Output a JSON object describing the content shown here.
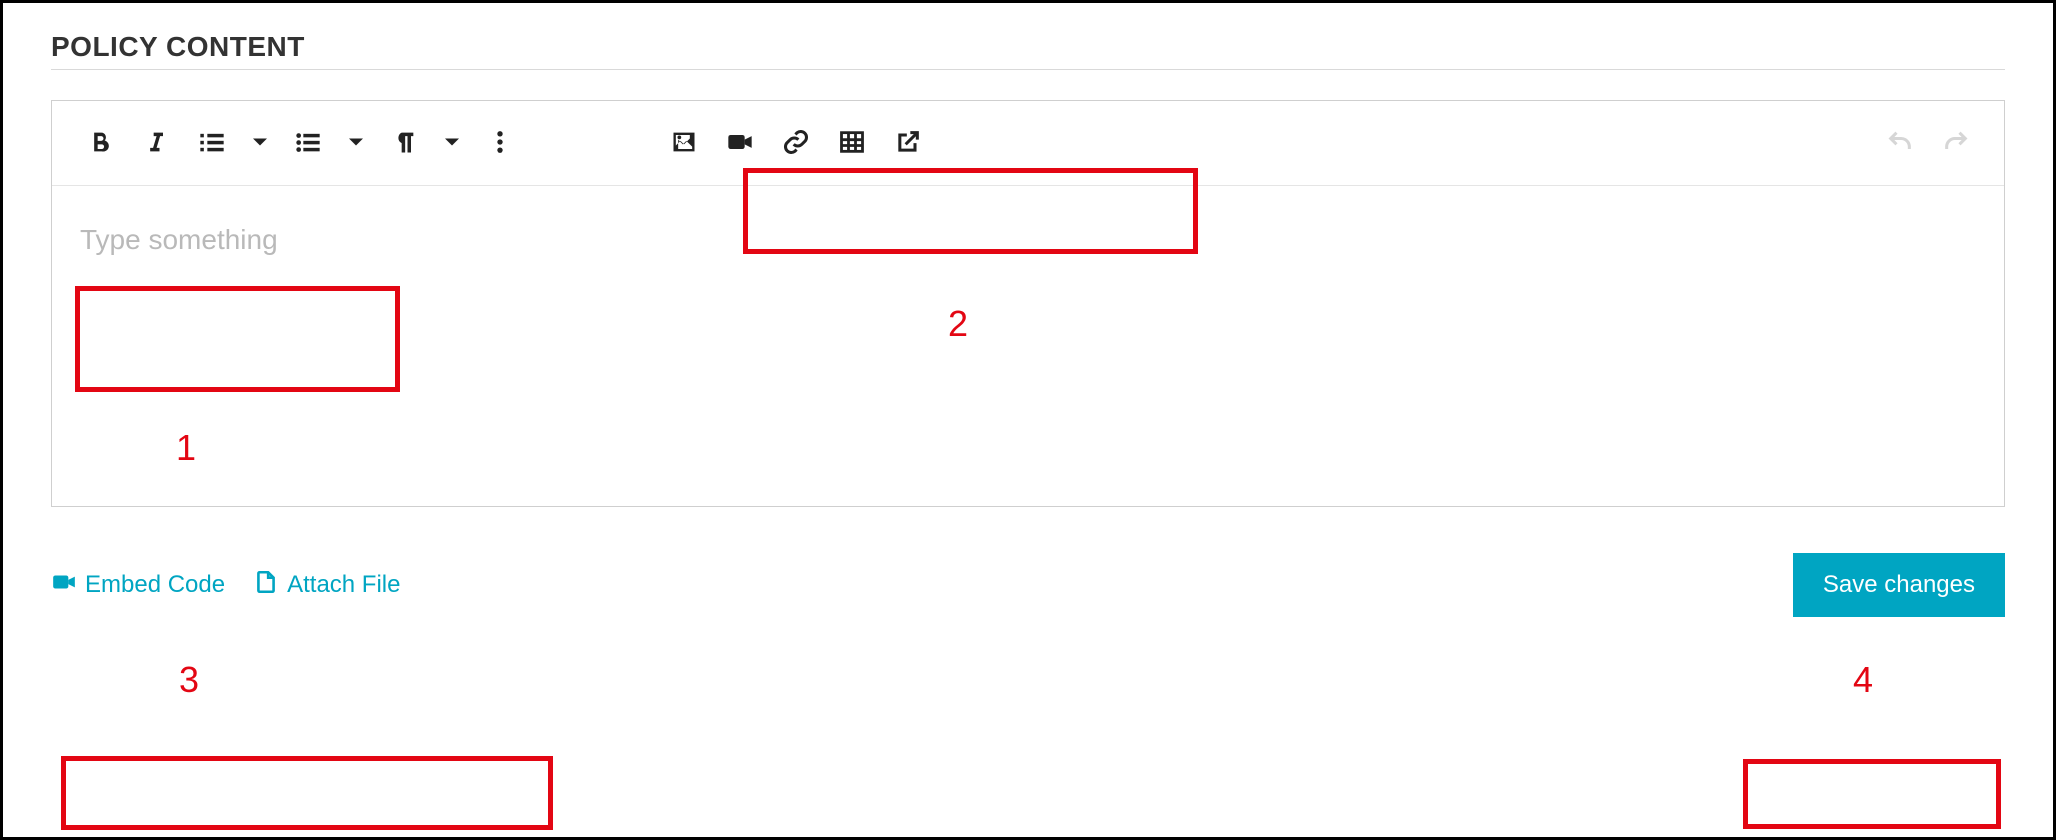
{
  "heading": "POLICY CONTENT",
  "editor": {
    "placeholder": "Type something"
  },
  "toolbar": {
    "bold": "Bold",
    "italic": "Italic",
    "ol": "Ordered list",
    "ul": "Unordered list",
    "paragraph": "Paragraph format",
    "more": "More options",
    "image": "Insert image",
    "video": "Insert video",
    "link": "Insert link",
    "table": "Insert table",
    "external": "Open link",
    "undo": "Undo",
    "redo": "Redo"
  },
  "footer": {
    "embed": "Embed Code",
    "attach": "Attach File",
    "save": "Save changes"
  },
  "annotations": {
    "one": "1",
    "two": "2",
    "three": "3",
    "four": "4"
  }
}
